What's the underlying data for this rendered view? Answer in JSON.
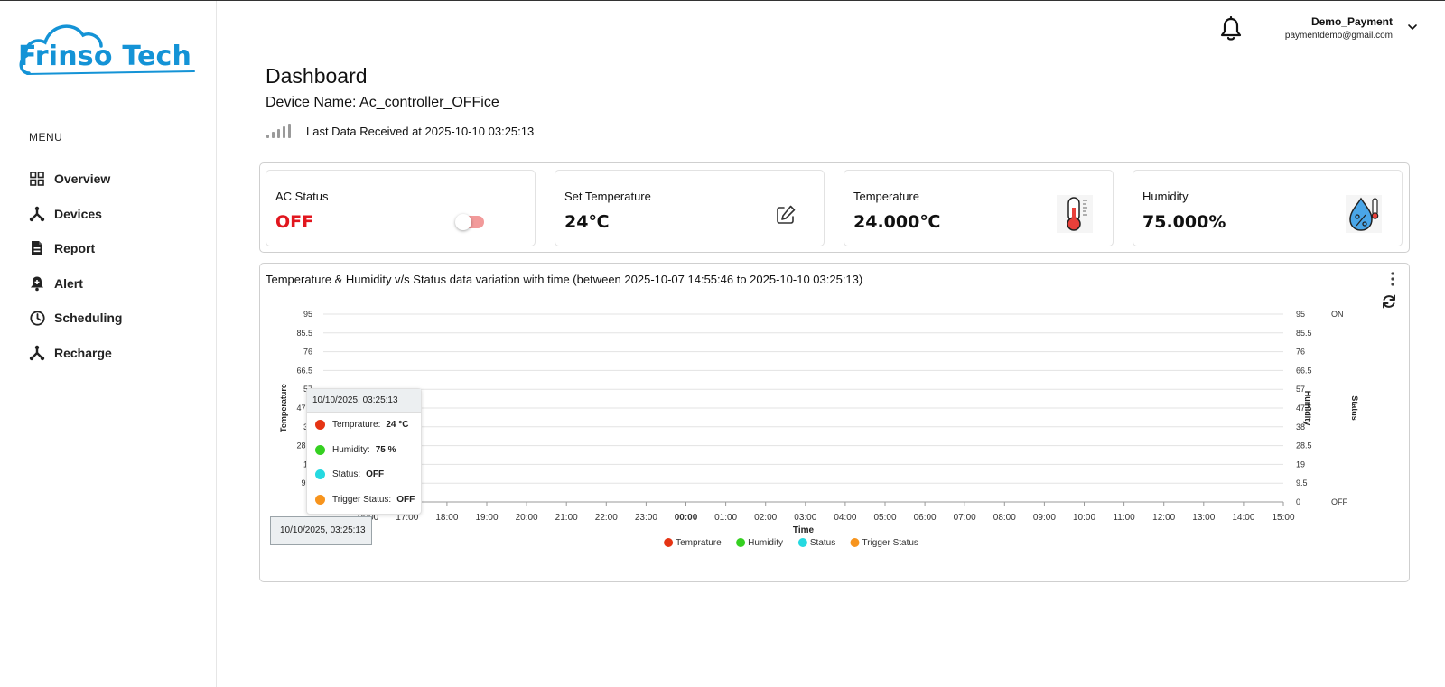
{
  "app": {
    "logo_text": "Frinso Tech"
  },
  "sidebar": {
    "menu_title": "MENU",
    "items": [
      {
        "label": "Overview",
        "icon": "grid-icon"
      },
      {
        "label": "Devices",
        "icon": "devices-icon"
      },
      {
        "label": "Report",
        "icon": "report-icon"
      },
      {
        "label": "Alert",
        "icon": "alert-bell-icon"
      },
      {
        "label": "Scheduling",
        "icon": "clock-icon"
      },
      {
        "label": "Recharge",
        "icon": "recharge-icon"
      }
    ]
  },
  "header": {
    "user_name": "Demo_Payment",
    "user_email": "paymentdemo@gmail.com"
  },
  "main": {
    "title": "Dashboard",
    "device_name": "Device Name: Ac_controller_OFFice",
    "last_data": "Last Data Received at 2025-10-10 03:25:13"
  },
  "cards": {
    "ac_status": {
      "label": "AC Status",
      "value": "OFF",
      "toggle_on": false
    },
    "set_temperature": {
      "label": "Set Temperature",
      "value": "24℃"
    },
    "temperature": {
      "label": "Temperature",
      "value": "24.000℃"
    },
    "humidity": {
      "label": "Humidity",
      "value": "75.000%"
    }
  },
  "colors": {
    "brand": "#1493d6",
    "off_red": "#e1161e",
    "temperature_series": "#e53414",
    "humidity_series": "#35d021",
    "status_series": "#25d9e0",
    "trigger_series": "#f7941d"
  },
  "tooltip": {
    "time": "10/10/2025, 03:25:13",
    "rows": [
      {
        "name": "Temprature:",
        "value": "24 °C"
      },
      {
        "name": "Humidity:",
        "value": "75 %"
      },
      {
        "name": "Status:",
        "value": "OFF"
      },
      {
        "name": "Trigger Status:",
        "value": "OFF"
      }
    ],
    "x_hover_label": "10/10/2025, 03:25:13"
  },
  "chart_data": {
    "type": "line",
    "title": "Temperature & Humidity v/s Status data variation with time (between 2025-10-07 14:55:46 to 2025-10-10 03:25:13)",
    "xlabel": "Time",
    "ylabel_left": "Temperature",
    "ylabel_right": "Humidity",
    "ylabel_status": "Status",
    "y_ticks": [
      "95",
      "85.5",
      "76",
      "66.5",
      "57",
      "47.5",
      "38",
      "28.5",
      "19",
      "9.5",
      "0"
    ],
    "ylim": [
      0,
      95
    ],
    "status_ticks": [
      "ON",
      "OFF"
    ],
    "x_ticks": [
      "16:00",
      "17:00",
      "18:00",
      "19:00",
      "20:00",
      "21:00",
      "22:00",
      "23:00",
      "00:00",
      "01:00",
      "02:00",
      "03:00",
      "04:00",
      "05:00",
      "06:00",
      "07:00",
      "08:00",
      "09:00",
      "10:00",
      "11:00",
      "12:00",
      "13:00",
      "14:00",
      "15:00"
    ],
    "x_bold_index": 8,
    "grid": true,
    "legend_position": "bottom",
    "series": [
      {
        "name": "Temprature",
        "color": "#e53414"
      },
      {
        "name": "Humidity",
        "color": "#35d021"
      },
      {
        "name": "Status",
        "color": "#25d9e0"
      },
      {
        "name": "Trigger Status",
        "color": "#f7941d"
      }
    ]
  }
}
